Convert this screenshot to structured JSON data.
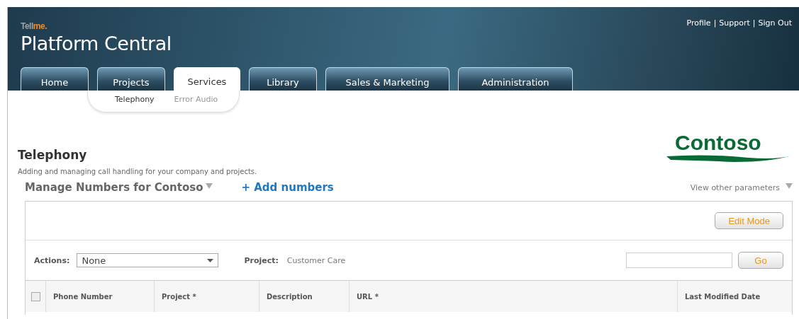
{
  "header": {
    "logo": {
      "prefix": "Tell",
      "suffix": "me."
    },
    "title": "Platform Central",
    "user_links": [
      "Profile",
      "Support",
      "Sign Out"
    ],
    "link_separator": "|"
  },
  "tabs": [
    {
      "label": "Home",
      "selected": false
    },
    {
      "label": "Projects",
      "selected": false
    },
    {
      "label": "Services",
      "selected": true
    },
    {
      "label": "Library",
      "selected": false
    },
    {
      "label": "Sales & Marketing",
      "selected": false
    },
    {
      "label": "Administration",
      "selected": false
    }
  ],
  "subtabs": [
    {
      "label": "Telephony",
      "selected": true
    },
    {
      "label": "Error Audio",
      "selected": false
    }
  ],
  "brand_logo": "Contoso",
  "page": {
    "title": "Telephony",
    "description": "Adding and managing call handling for your company and projects.",
    "section_title": "Manage Numbers for Contoso",
    "add_link": "+ Add numbers",
    "parameters_link": "View other parameters"
  },
  "toolbar": {
    "edit_button": "Edit Mode",
    "actions_label": "Actions:",
    "actions_value": "None",
    "project_label": "Project:",
    "project_value": "Customer Care",
    "go_button": "Go"
  },
  "table": {
    "select_all_checked": false,
    "columns": [
      "Phone Number",
      "Project *",
      "Description",
      "URL *",
      "Last Modified Date"
    ]
  }
}
